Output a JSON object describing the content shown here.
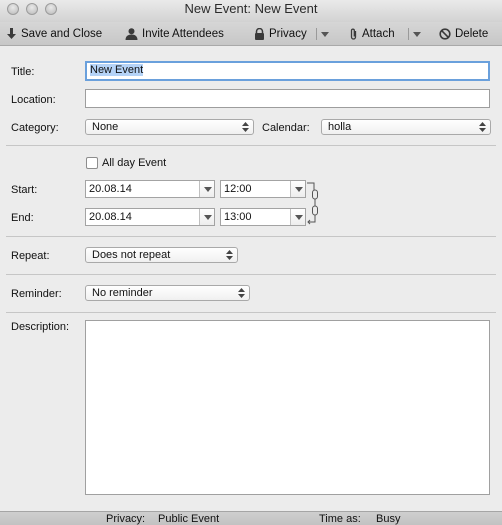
{
  "window": {
    "title": "New Event: New Event"
  },
  "toolbar": {
    "save_close": "Save and Close",
    "invite": "Invite Attendees",
    "privacy": "Privacy",
    "attach": "Attach",
    "delete": "Delete"
  },
  "form": {
    "title_label": "Title:",
    "title_value": "New Event",
    "location_label": "Location:",
    "location_value": "",
    "category_label": "Category:",
    "category_value": "None",
    "calendar_label": "Calendar:",
    "calendar_value": "holla",
    "allday_label": "All day Event",
    "start_label": "Start:",
    "start_date": "20.08.14",
    "start_time": "12:00",
    "end_label": "End:",
    "end_date": "20.08.14",
    "end_time": "13:00",
    "repeat_label": "Repeat:",
    "repeat_value": "Does not repeat",
    "reminder_label": "Reminder:",
    "reminder_value": "No reminder",
    "description_label": "Description:",
    "description_value": ""
  },
  "status": {
    "privacy_label": "Privacy:",
    "privacy_value": "Public Event",
    "timeas_label": "Time as:",
    "timeas_value": "Busy"
  },
  "icons": {
    "traffic_lights": [
      "close-icon",
      "minimize-icon",
      "zoom-icon"
    ],
    "save": "save-down-arrow-icon",
    "invite": "person-icon",
    "privacy": "lock-icon",
    "attach": "paperclip-icon",
    "delete": "no-sign-icon",
    "link": "chain-link-icon"
  }
}
